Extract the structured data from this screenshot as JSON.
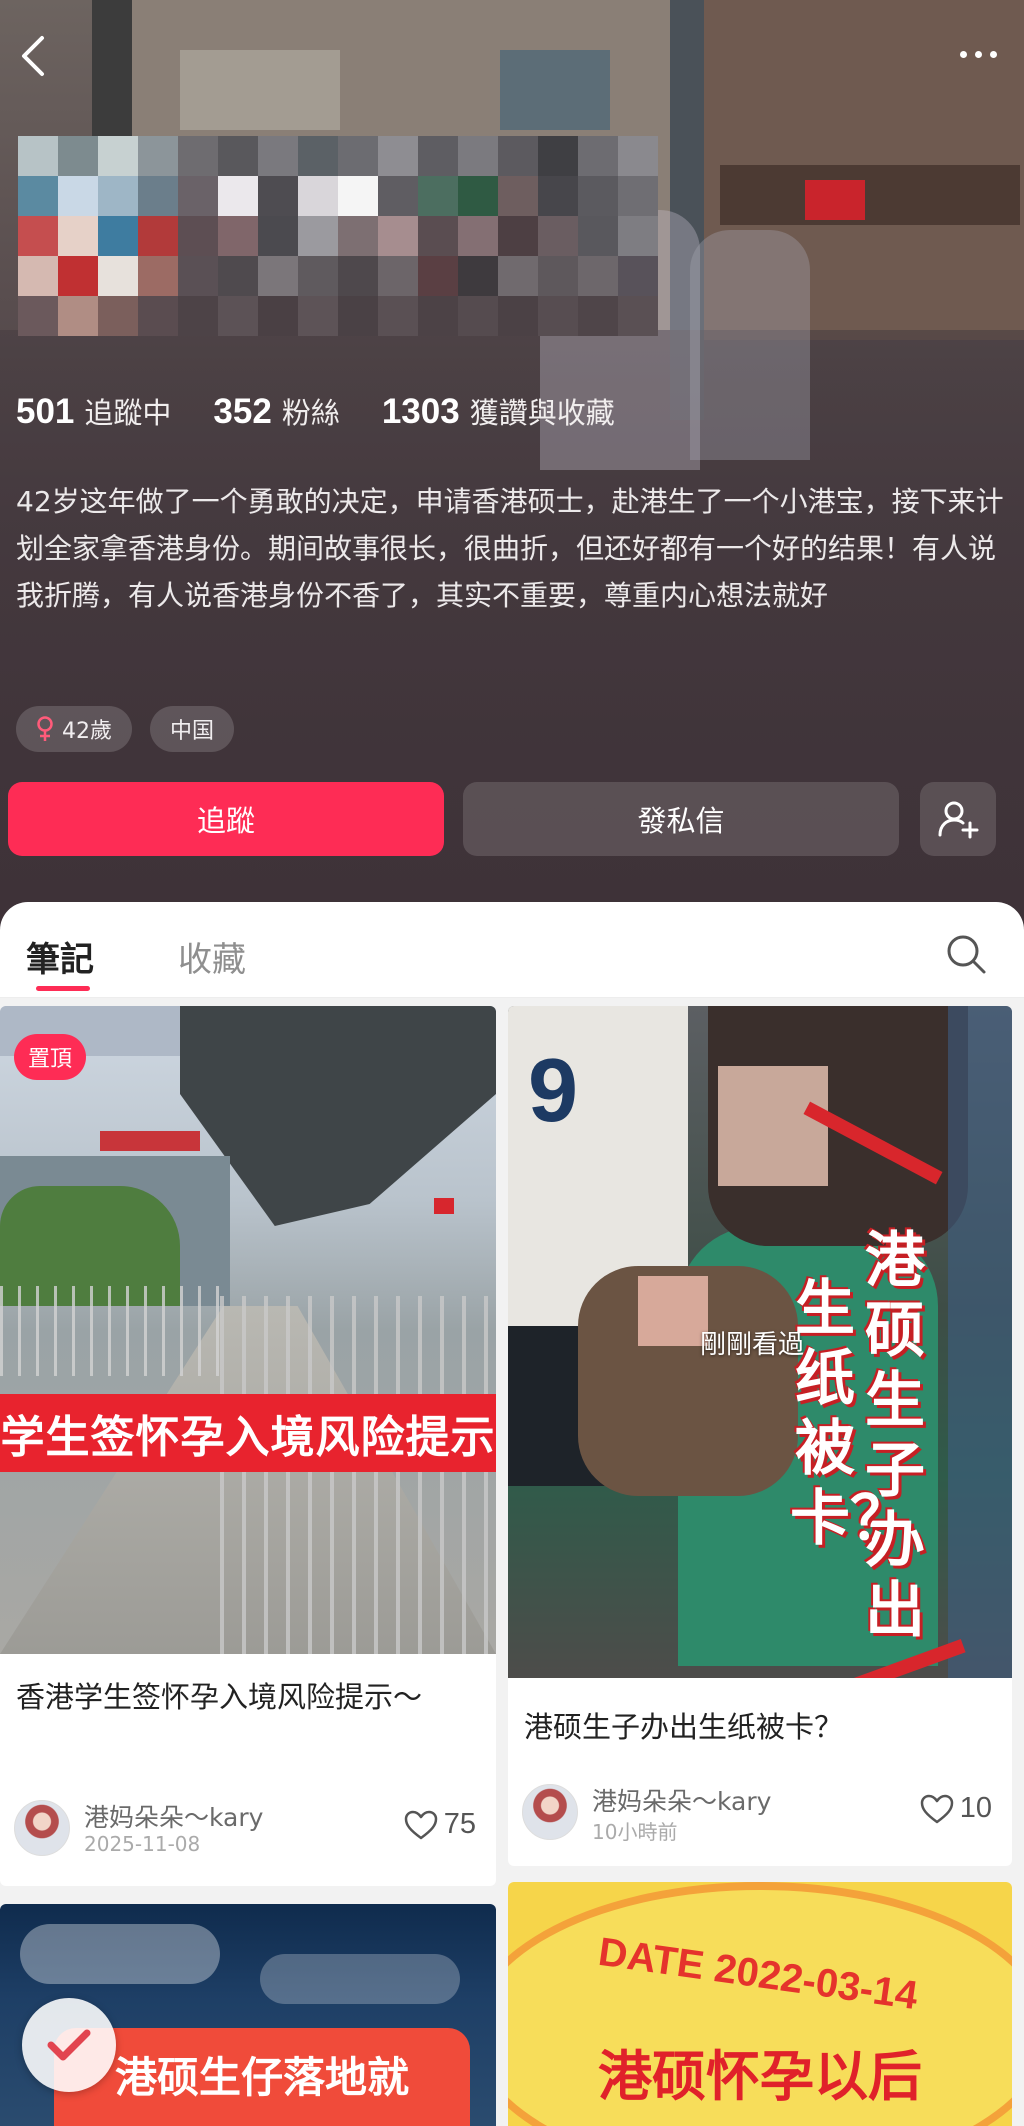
{
  "header": {
    "stats": [
      {
        "value": "501",
        "label": "追蹤中"
      },
      {
        "value": "352",
        "label": "粉絲"
      },
      {
        "value": "1303",
        "label": "獲讚與收藏"
      }
    ],
    "bio": "42岁这年做了一个勇敢的决定，申请香港硕士，赴港生了一个小港宝，接下来计划全家拿香港身份。期间故事很长，很曲折，但还好都有一个好的结果！有人说我折腾，有人说香港身份不香了，其实不重要，尊重内心想法就好",
    "tags": [
      "42歲",
      "中国"
    ],
    "follow_label": "追蹤",
    "message_label": "發私信"
  },
  "tabs": {
    "notes": "筆記",
    "saved": "收藏"
  },
  "feed": {
    "cards": [
      {
        "title": "香港学生签怀孕入境风险提示～",
        "pin_badge": "置頂",
        "image_text": "学生签怀孕入境风险提示",
        "author": "港妈朵朵～kary",
        "date": "2025-11-08",
        "likes": "75"
      },
      {
        "title": "港硕生子办出生纸被卡？",
        "seen_label": "剛剛看過",
        "image_text_col1": "港硕生子办出",
        "image_text_col2": "生纸被卡？",
        "author": "港妈朵朵～kary",
        "date": "10小時前",
        "likes": "10"
      },
      {
        "image_text": "港硕生仔落地就"
      },
      {
        "image_date": "DATE 2022-03-14",
        "image_text": "港硕怀孕以后"
      }
    ]
  },
  "colors": {
    "accent": "#fe2c55",
    "header_bg": "#4b3f44"
  }
}
